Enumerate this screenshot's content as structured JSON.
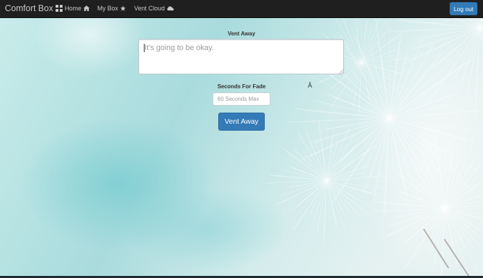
{
  "navbar": {
    "brand": "Comfort Box",
    "brand_icon": "grid-icon",
    "links": [
      {
        "label": "Home",
        "icon": "home-icon"
      },
      {
        "label": "My Box",
        "icon": "star-icon"
      },
      {
        "label": "Vent Cloud",
        "icon": "cloud-icon"
      }
    ],
    "logout_label": "Log out"
  },
  "form": {
    "title": "Vent Away",
    "textarea_placeholder": "It's going to be okay.",
    "seconds_label": "Seconds For Fade",
    "stray_char": "Â",
    "seconds_placeholder": "60 Seconds Max",
    "submit_label": "Vent Away"
  },
  "colors": {
    "navbar": "#1f1f1f",
    "primary": "#337ab7",
    "background": "#cfe9ea"
  }
}
